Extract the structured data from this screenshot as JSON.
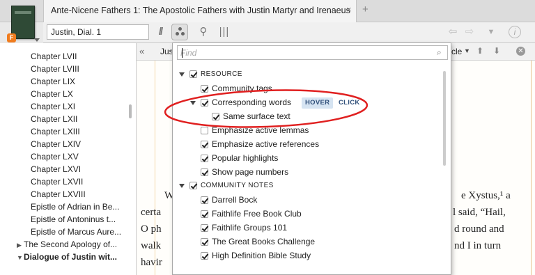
{
  "tab": {
    "title": "Ante-Nicene Fathers 1: The Apostolic Fathers with Justin Martyr and Irenaeus",
    "close": "×",
    "add": "+"
  },
  "resource_badge": "F",
  "toolbar": {
    "reference": "Justin, Dial. 1",
    "parallel_glyph": "//",
    "search_glyph": "⚲",
    "bars_glyph": "|||",
    "back_glyph": "⇦",
    "forward_glyph": "⇨",
    "history_glyph": "▼",
    "info_glyph": "i"
  },
  "sidebar": {
    "items": [
      {
        "label": "Chapter LVII"
      },
      {
        "label": "Chapter LVIII"
      },
      {
        "label": "Chapter LIX"
      },
      {
        "label": "Chapter LX"
      },
      {
        "label": "Chapter LXI"
      },
      {
        "label": "Chapter LXII"
      },
      {
        "label": "Chapter LXIII"
      },
      {
        "label": "Chapter LXIV"
      },
      {
        "label": "Chapter LXV"
      },
      {
        "label": "Chapter LXVI"
      },
      {
        "label": "Chapter LXVII"
      },
      {
        "label": "Chapter LXVIII"
      },
      {
        "label": "Epistle of Adrian in Be..."
      },
      {
        "label": "Epistle of Antoninus t..."
      },
      {
        "label": "Epistle of Marcus Aure..."
      },
      {
        "label": "The Second Apology of..."
      },
      {
        "label": "Dialogue of Justin wit..."
      }
    ],
    "collapsed_arrow": "▶",
    "expanded_arrow": "▼"
  },
  "pane": {
    "prev_glyph": "«",
    "crumb": "Jus",
    "right_label": "cle",
    "caret": "▼",
    "up_glyph": "⬆",
    "down_glyph": "⬇",
    "close_glyph": "✕",
    "text_lines": [
      {
        "left": "W",
        "right": "e Xystus,¹ a"
      },
      {
        "left": "certa",
        "right": "l said, “Hail,"
      },
      {
        "left": "O ph",
        "right": "d round and"
      },
      {
        "left": "walk",
        "right": "nd I in turn"
      },
      {
        "left": "havir",
        "right": ""
      }
    ]
  },
  "popup": {
    "find_placeholder": "Find",
    "search_icon": "⌕",
    "sections": {
      "resource": "RESOURCE",
      "community_notes": "COMMUNITY NOTES"
    },
    "resource_items": {
      "community_tags": "Community tags",
      "corresponding_words": "Corresponding words",
      "hover": "HOVER",
      "click": "CLICK",
      "same_surface_text": "Same surface text",
      "emphasize_lemmas": "Emphasize active lemmas",
      "emphasize_references": "Emphasize active references",
      "popular_highlights": "Popular highlights",
      "show_page_numbers": "Show page numbers"
    },
    "community_items": {
      "darrell_bock": "Darrell Bock",
      "faithlife_book_club": "Faithlife Free Book Club",
      "faithlife_groups": "Faithlife Groups 101",
      "great_books": "The Great Books Challenge",
      "hd_bible_study": "High Definition Bible Study"
    }
  },
  "colors": {
    "annotation_ellipse": "#e02020",
    "hover_badge_bg": "#d6e4f2",
    "badge_text": "#31507a",
    "resource_badge": "#f07c1e"
  }
}
